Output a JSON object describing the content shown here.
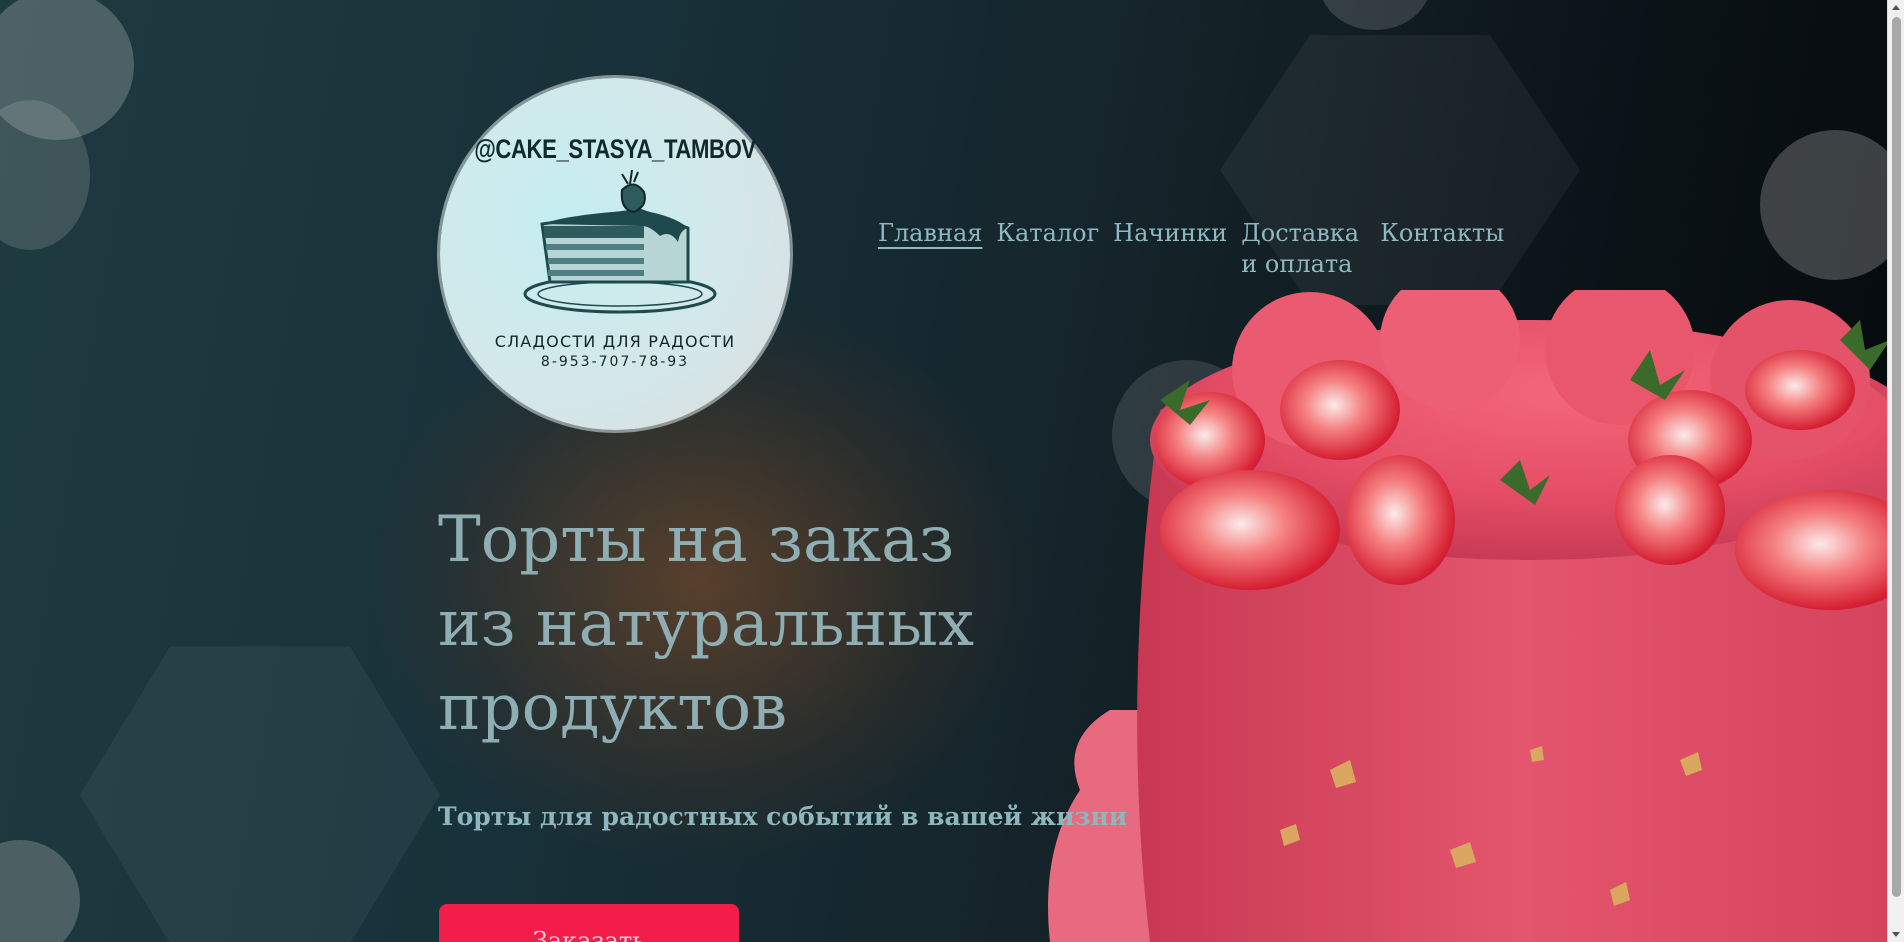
{
  "logo": {
    "handle": "@CAKE_STASYA_TAMBOV",
    "tagline": "СЛАДОСТИ ДЛЯ РАДОСТИ",
    "phone": "8-953-707-78-93"
  },
  "nav": {
    "items": [
      {
        "label": "Главная",
        "active": true
      },
      {
        "label": "Каталог",
        "active": false
      },
      {
        "label": "Начинки",
        "active": false
      },
      {
        "label": "Доставка и оплата",
        "active": false
      },
      {
        "label": "Контакты",
        "active": false
      }
    ]
  },
  "hero": {
    "title_line1": "Торты на заказ",
    "title_line2": "из натуральных",
    "title_line3": "продуктов",
    "subtitle": "Торты для радостных событий в вашей жизни",
    "order_button": "Заказать"
  },
  "colors": {
    "accent": "#f31d4a",
    "nav_text": "#8fb9c0",
    "title_text": "#8eaeb3"
  },
  "icons": {
    "logo_image": "cake-slice-icon",
    "hero_image": "strawberry-cake-photo"
  }
}
